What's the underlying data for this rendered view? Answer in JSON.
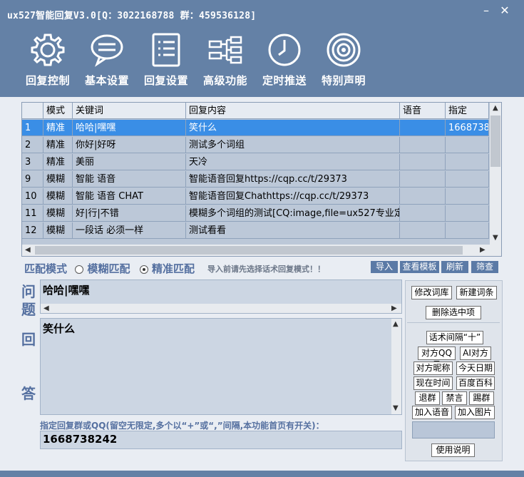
{
  "window": {
    "title": "ux527智能回复V3.0[Q：3022168788 群：459536128]",
    "minimize": "–",
    "close": "✕"
  },
  "toolbar": [
    {
      "label": "回复控制",
      "icon": "gear-icon"
    },
    {
      "label": "基本设置",
      "icon": "chat-bubble-icon"
    },
    {
      "label": "回复设置",
      "icon": "list-document-icon"
    },
    {
      "label": "高级功能",
      "icon": "network-icon"
    },
    {
      "label": "定时推送",
      "icon": "clock-icon"
    },
    {
      "label": "特别声明",
      "icon": "target-icon"
    }
  ],
  "grid": {
    "columns": [
      "",
      "模式",
      "关键词",
      "回复内容",
      "语音",
      "指定"
    ],
    "rows": [
      [
        "1",
        "精准",
        "哈哈|嘿嘿",
        "笑什么",
        "",
        "1668738"
      ],
      [
        "2",
        "精准",
        "你好|好呀",
        "测试多个词组",
        "",
        ""
      ],
      [
        "3",
        "精准",
        "美丽",
        "天冷",
        "",
        ""
      ],
      [
        "9",
        "模糊",
        "智能 语音",
        "智能语音回复https://cqp.cc/t/29373",
        "",
        ""
      ],
      [
        "10",
        "模糊",
        "智能 语音 CHAT",
        "智能语音回复Chathttps://cqp.cc/t/29373",
        "",
        ""
      ],
      [
        "11",
        "模糊",
        "好|行|不错",
        "模糊多个词组的测试[CQ:image,file=ux527专业定制",
        "",
        ""
      ],
      [
        "12",
        "模糊",
        "一段话 必须一样",
        "测试看看",
        "",
        ""
      ]
    ],
    "selected_row": 0
  },
  "match": {
    "label": "匹配模式",
    "fuzzy": "模糊匹配",
    "exact": "精准匹配",
    "selected": "精准匹配"
  },
  "hint": "导入前请先选择话术回复模式！！",
  "top_buttons": [
    "导入",
    "查看模板",
    "刷新",
    "筛查"
  ],
  "question": {
    "label_1": "问",
    "label_2": "题",
    "value": "哈哈|嘿嘿"
  },
  "answer": {
    "label_1": "回",
    "label_2": "答",
    "value": "笑什么"
  },
  "notice": "指定回复群或QQ(留空无限定,多个以“+”或“,”间隔,本功能首页有开关)：",
  "target_value": "1668738242",
  "panel": {
    "modify": "修改词库",
    "create": "新建词条",
    "delete": "删除选中项",
    "separator": "话术间隔“十”",
    "peer_qq": "对方QQ号",
    "ai_peer": "AI对方",
    "peer_nick": "对方昵称",
    "today": "今天日期",
    "now": "现在时间",
    "baike": "百度百科",
    "leave_group": "退群",
    "mute": "禁言",
    "kick": "踢群",
    "add_voice": "加入语音",
    "add_image": "加入图片",
    "usage": "使用说明"
  }
}
